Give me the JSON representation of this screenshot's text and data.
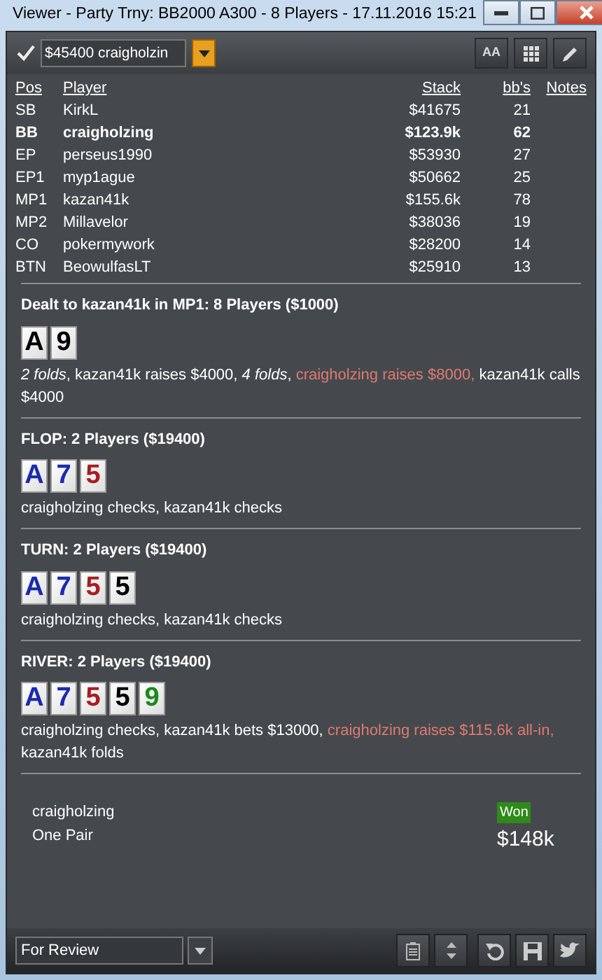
{
  "window": {
    "title": "Viewer - Party Trny: BB2000 A300 - 8 Players - 17.11.2016 15:21"
  },
  "toolbar": {
    "checkbox": {
      "checked": true
    },
    "hand_select": {
      "value": "$45400 craigholzin"
    },
    "font_button": "AA"
  },
  "players": {
    "columns": [
      "Pos",
      "Player",
      "Stack",
      "bb's",
      "Notes"
    ],
    "rows": [
      {
        "pos": "SB",
        "player": "KirkL",
        "stack": "$41675",
        "bbs": "21",
        "highlighted": false
      },
      {
        "pos": "BB",
        "player": "craigholzing",
        "stack": "$123.9k",
        "bbs": "62",
        "highlighted": true
      },
      {
        "pos": "EP",
        "player": "perseus1990",
        "stack": "$53930",
        "bbs": "27",
        "highlighted": false
      },
      {
        "pos": "EP1",
        "player": "myp1ague",
        "stack": "$50662",
        "bbs": "25",
        "highlighted": false
      },
      {
        "pos": "MP1",
        "player": "kazan41k",
        "stack": "$155.6k",
        "bbs": "78",
        "highlighted": false
      },
      {
        "pos": "MP2",
        "player": "Millavelor",
        "stack": "$38036",
        "bbs": "19",
        "highlighted": false
      },
      {
        "pos": "CO",
        "player": "pokermywork",
        "stack": "$28200",
        "bbs": "14",
        "highlighted": false
      },
      {
        "pos": "BTN",
        "player": "BeowulfasLT",
        "stack": "$25910",
        "bbs": "13",
        "highlighted": false
      }
    ]
  },
  "streets": [
    {
      "title": "Dealt to kazan41k in MP1: 8 Players ($1000)",
      "cards": [
        {
          "rank": "A",
          "color": "#000000"
        },
        {
          "rank": "9",
          "color": "#000000"
        }
      ],
      "actions": [
        {
          "text": "2 folds",
          "kind": "fold"
        },
        {
          "text": ", kazan41k raises $4000, ",
          "kind": "normal"
        },
        {
          "text": "4 folds",
          "kind": "fold"
        },
        {
          "text": ", ",
          "kind": "normal"
        },
        {
          "text": "craigholzing raises $8000,",
          "kind": "hero"
        },
        {
          "text": " kazan41k calls $4000",
          "kind": "normal"
        }
      ]
    },
    {
      "title": "FLOP: 2 Players ($19400)",
      "cards": [
        {
          "rank": "A",
          "color": "#1a2ab0"
        },
        {
          "rank": "7",
          "color": "#1a2ab0"
        },
        {
          "rank": "5",
          "color": "#a81c22"
        }
      ],
      "actions": [
        {
          "text": "craigholzing checks, kazan41k checks",
          "kind": "normal"
        }
      ]
    },
    {
      "title": "TURN: 2 Players ($19400)",
      "cards": [
        {
          "rank": "A",
          "color": "#1a2ab0"
        },
        {
          "rank": "7",
          "color": "#1a2ab0"
        },
        {
          "rank": "5",
          "color": "#a81c22"
        },
        {
          "rank": "5",
          "color": "#000000"
        }
      ],
      "actions": [
        {
          "text": "craigholzing checks, kazan41k checks",
          "kind": "normal"
        }
      ]
    },
    {
      "title": "RIVER: 2 Players ($19400)",
      "cards": [
        {
          "rank": "A",
          "color": "#1a2ab0"
        },
        {
          "rank": "7",
          "color": "#1a2ab0"
        },
        {
          "rank": "5",
          "color": "#a81c22"
        },
        {
          "rank": "5",
          "color": "#000000"
        },
        {
          "rank": "9",
          "color": "#1a8a1a"
        }
      ],
      "actions": [
        {
          "text": "craigholzing checks, kazan41k bets $13000, ",
          "kind": "normal"
        },
        {
          "text": "craigholzing raises $115.6k all-in,",
          "kind": "hero"
        },
        {
          "text": " kazan41k folds",
          "kind": "normal"
        }
      ]
    }
  ],
  "result": {
    "player": "craigholzing",
    "hand": "One Pair",
    "badge": "Won",
    "amount": "$148k"
  },
  "footer": {
    "tag_select": {
      "value": "For Review"
    }
  }
}
